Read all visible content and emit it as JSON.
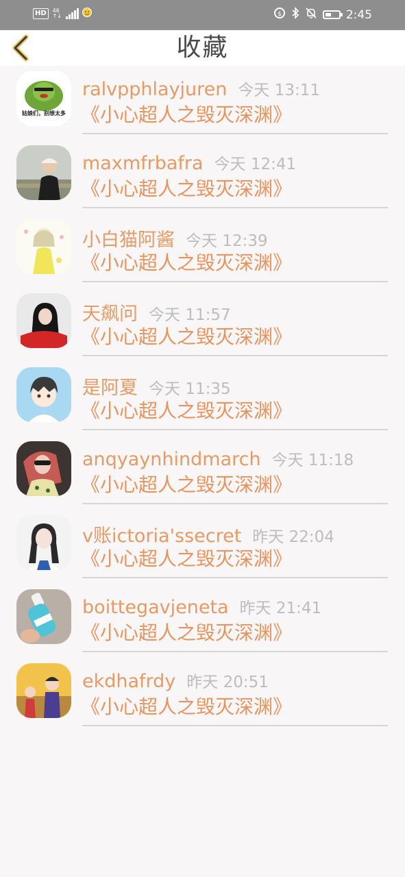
{
  "statusbar": {
    "hd": "HD",
    "net_top": "46",
    "net_bottom": "↑↓",
    "time": "2:45"
  },
  "header": {
    "title": "收藏"
  },
  "favorites": [
    {
      "user": "ralvpphlayjuren",
      "time": "今天 13:11",
      "book": "《小心超人之毁灭深渊》"
    },
    {
      "user": "maxmfrbafra",
      "time": "今天 12:41",
      "book": "《小心超人之毁灭深渊》"
    },
    {
      "user": "小白猫阿酱",
      "time": "今天 12:39",
      "book": "《小心超人之毁灭深渊》"
    },
    {
      "user": "天飙问",
      "time": "今天 11:57",
      "book": "《小心超人之毁灭深渊》"
    },
    {
      "user": "是阿夏",
      "time": "今天 11:35",
      "book": "《小心超人之毁灭深渊》"
    },
    {
      "user": "anqyaynhindmarch",
      "time": "今天 11:18",
      "book": "《小心超人之毁灭深渊》"
    },
    {
      "user": "v账ictoria'ssecret",
      "time": "昨天 22:04",
      "book": "《小心超人之毁灭深渊》"
    },
    {
      "user": "boittegavjeneta",
      "time": "昨天 21:41",
      "book": "《小心超人之毁灭深渊》"
    },
    {
      "user": "ekdhafrdy",
      "time": "昨天 20:51",
      "book": "《小心超人之毁灭深渊》"
    }
  ],
  "avatar_text": {
    "first": "姑娘们，别想太多"
  },
  "colors": {
    "accent": "#e8945f",
    "back_arrow": "#e7c35a",
    "time_gray": "#bdbdbd"
  }
}
